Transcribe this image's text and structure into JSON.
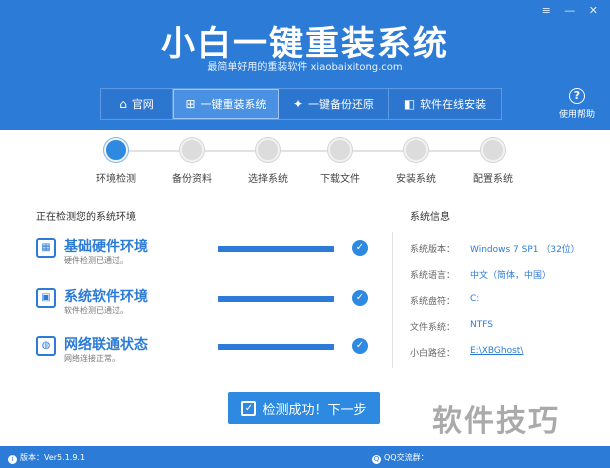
{
  "app": {
    "title": "小白一键重装系统",
    "subtitle": "最简单好用的重装软件 xiaobaixitong.com"
  },
  "window_controls": {
    "menu": "≡",
    "minimize": "—",
    "close": "✕"
  },
  "nav": [
    {
      "label": "官网",
      "icon": "home-icon",
      "glyph": "⌂"
    },
    {
      "label": "一键重装系统",
      "icon": "windows-icon",
      "glyph": "⊞",
      "active": true
    },
    {
      "label": "一键备份还原",
      "icon": "bird-icon",
      "glyph": "✦"
    },
    {
      "label": "软件在线安装",
      "icon": "apps-icon",
      "glyph": "◧"
    }
  ],
  "help": {
    "label": "使用帮助",
    "glyph": "?"
  },
  "steps": [
    {
      "label": "环境检测",
      "active": true
    },
    {
      "label": "备份资料",
      "active": false
    },
    {
      "label": "选择系统",
      "active": false
    },
    {
      "label": "下载文件",
      "active": false
    },
    {
      "label": "安装系统",
      "active": false
    },
    {
      "label": "配置系统",
      "active": false
    }
  ],
  "checks": {
    "section_title": "正在检测您的系统环境",
    "items": [
      {
        "name": "基础硬件环境",
        "desc": "硬件检测已通过。",
        "icon": "hardware-icon",
        "glyph": "▦",
        "progress": 1.0
      },
      {
        "name": "系统软件环境",
        "desc": "软件检测已通过。",
        "icon": "software-icon",
        "glyph": "▣",
        "progress": 1.0
      },
      {
        "name": "网络联通状态",
        "desc": "网络连接正常。",
        "icon": "network-icon",
        "glyph": "◍",
        "progress": 1.0
      }
    ]
  },
  "system_info": {
    "title": "系统信息",
    "rows": [
      {
        "key": "系统版本：",
        "value": "Windows 7 SP1 （32位）"
      },
      {
        "key": "系统语言：",
        "value": "中文（简体，中国）"
      },
      {
        "key": "系统盘符：",
        "value": "C:"
      },
      {
        "key": "文件系统：",
        "value": "NTFS"
      },
      {
        "key": "小白路径：",
        "value": "E:\\XBGhost\\",
        "link": true
      }
    ]
  },
  "next_button": {
    "label": "检测成功！下一步",
    "glyph": "✓"
  },
  "footer": {
    "version": "版本：Ver5.1.9.1",
    "qq": "QQ交流群："
  },
  "watermark": "软件技巧",
  "colors": {
    "primary": "#2b7bd7",
    "accent": "#2d8ae0"
  }
}
